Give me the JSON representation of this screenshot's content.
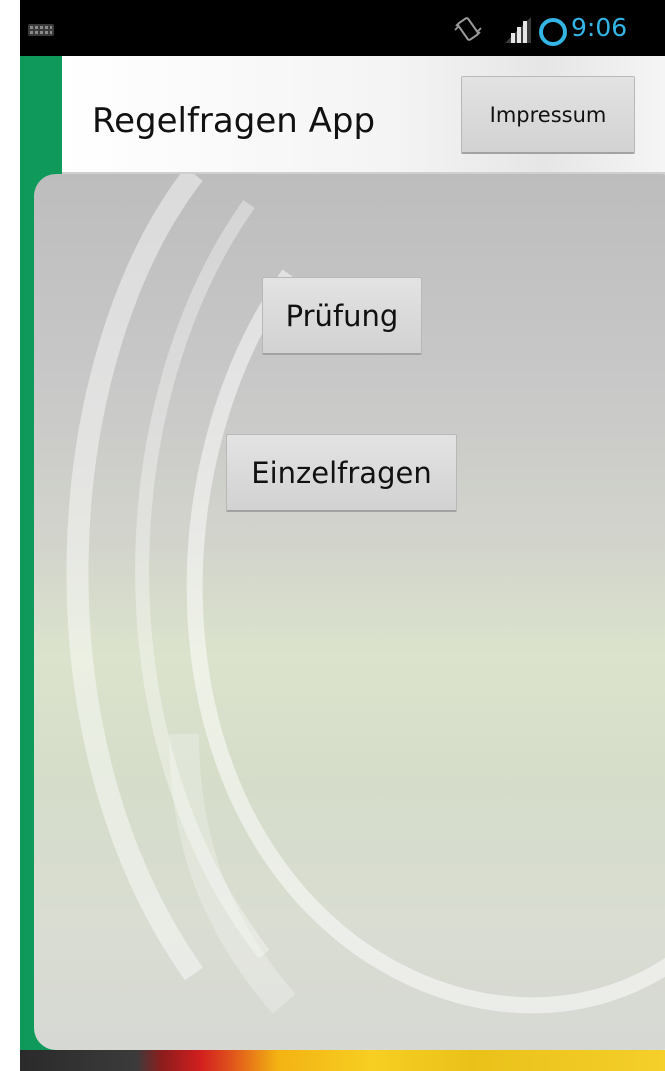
{
  "status_bar": {
    "time": "9:06",
    "icons": [
      "keyboard-icon",
      "vibrate-icon",
      "signal-icon",
      "sync-icon"
    ],
    "accent_color": "#33b5e5"
  },
  "action_bar": {
    "title": "Regelfragen App",
    "impressum_label": "Impressum"
  },
  "main": {
    "pruefung_label": "Prüfung",
    "einzelfragen_label": "Einzelfragen"
  },
  "colors": {
    "brand_green": "#0f9a5b",
    "button_face": "#d9d9d9"
  }
}
